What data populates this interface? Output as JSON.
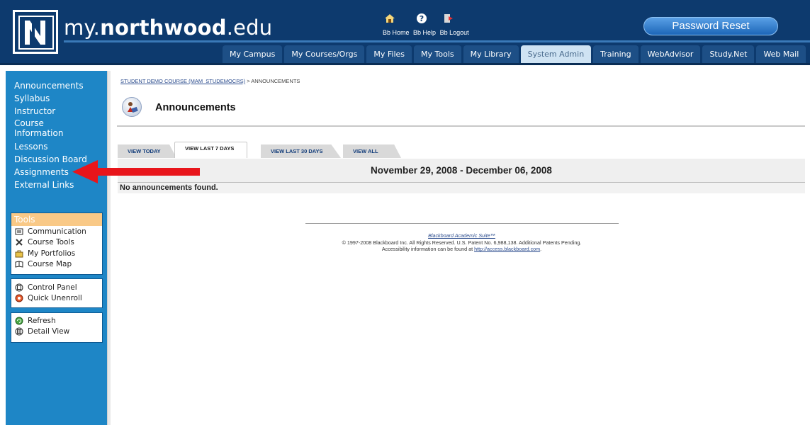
{
  "header": {
    "site_name_prefix": "my.",
    "site_name_bold": "northwood",
    "site_name_suffix": ".edu",
    "bb_links": [
      "Bb Home",
      "Bb Help",
      "Bb Logout"
    ],
    "password_reset": "Password Reset"
  },
  "nav_tabs": [
    "My Campus",
    "My Courses/Orgs",
    "My Files",
    "My Tools",
    "My Library",
    "System Admin",
    "Training",
    "WebAdvisor",
    "Study.Net",
    "Web Mail"
  ],
  "active_nav_tab": "System Admin",
  "sidebar": {
    "course_links": [
      "Announcements",
      "Syllabus",
      "Instructor",
      "Course Information",
      "Lessons",
      "Discussion Board",
      "Assignments",
      "External Links"
    ],
    "tools_title": "Tools",
    "tools": [
      "Communication",
      "Course Tools",
      "My Portfolios",
      "Course Map"
    ],
    "panel_items": [
      "Control Panel",
      "Quick Unenroll"
    ],
    "view_items": [
      "Refresh",
      "Detail View"
    ]
  },
  "content": {
    "breadcrumb_link": "STUDENT DEMO COURSE (MAM_STUDEMOCRS)",
    "breadcrumb_current": " > ANNOUNCEMENTS",
    "page_title": "Announcements",
    "view_tabs": [
      "VIEW TODAY",
      "VIEW LAST 7 DAYS",
      "VIEW LAST 30 DAYS",
      "VIEW ALL"
    ],
    "active_view_tab": "VIEW LAST 7 DAYS",
    "date_range": "November 29, 2008 - December 06, 2008",
    "empty_message": "No announcements found."
  },
  "footer": {
    "suite_name": "Blackboard Academic Suite™",
    "copyright": "© 1997-2008 Blackboard Inc. All Rights Reserved. U.S. Patent No. 6,988,138. Additional Patents Pending.",
    "accessibility_prefix": "Accessibility information can be found at ",
    "accessibility_link": "http://access.blackboard.com",
    "accessibility_suffix": "."
  },
  "colors": {
    "header_bg": "#0d3a6e",
    "sidebar_bg": "#1e86c6",
    "tools_header": "#f9c987",
    "arrow": "#e8151b"
  }
}
